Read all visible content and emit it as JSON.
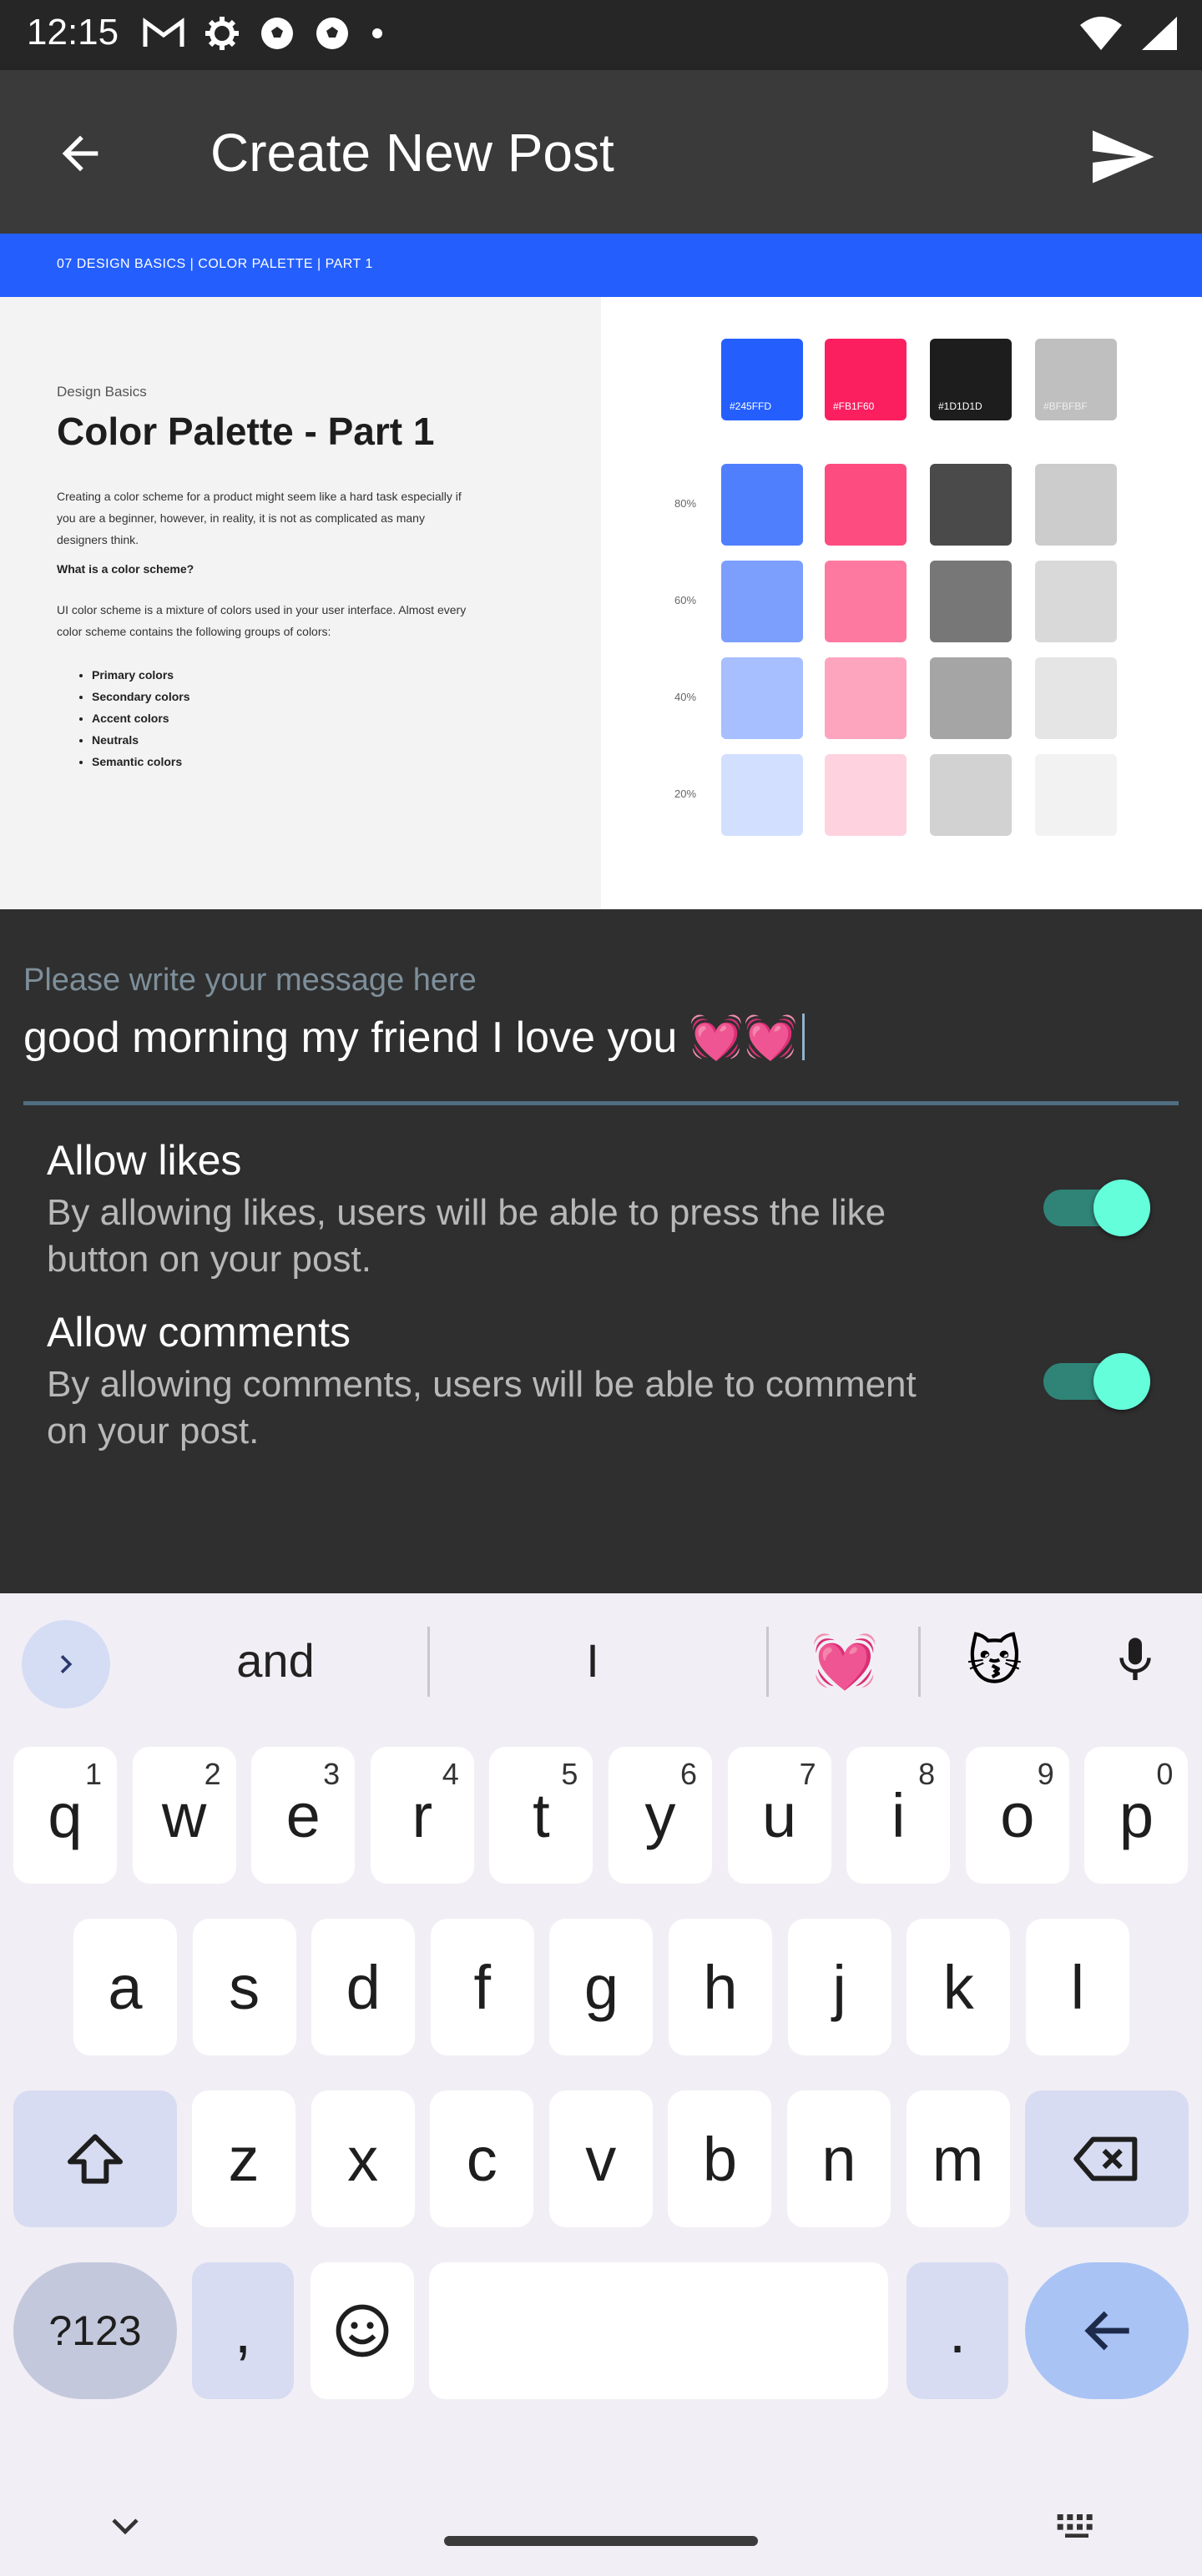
{
  "status_bar": {
    "time": "12:15",
    "icons": [
      "gmail-icon",
      "settings-icon",
      "soccer-ball-icon",
      "soccer-ball-icon",
      "dot-icon"
    ],
    "right_icons": [
      "wifi-icon",
      "signal-icon"
    ]
  },
  "app_bar": {
    "title": "Create New Post",
    "back_icon": "arrow-back-icon",
    "send_icon": "send-icon"
  },
  "post_image": {
    "banner": "07 DESIGN BASICS | COLOR PALETTE | PART 1",
    "subtitle": "Design Basics",
    "title": "Color Palette - Part 1",
    "paragraph1": "Creating a color scheme for a product might seem like a hard task especially if you are a beginner, however, in reality, it is not as complicated as many designers think.",
    "heading2": "What is a color scheme?",
    "paragraph2": "UI color scheme is a mixture of colors used in your user interface. Almost every color scheme contains the following groups of colors:",
    "list": [
      "Primary colors",
      "Secondary colors",
      "Accent colors",
      "Neutrals",
      "Semantic colors"
    ],
    "swatch_names": [
      "#245FFD",
      "#FB1F60",
      "#1D1D1D",
      "#BFBFBF"
    ],
    "shade_labels": [
      "80%",
      "60%",
      "40%",
      "20%"
    ],
    "colors": {
      "base": [
        "#245ffd",
        "#fb1f60",
        "#1d1d1d",
        "#bfbfbf"
      ],
      "80": [
        "#4f7ffd",
        "#fc4c80",
        "#4a4a4a",
        "#cccccc"
      ],
      "60": [
        "#7c9ffe",
        "#fd79a0",
        "#777777",
        "#d9d9d9"
      ],
      "40": [
        "#a7bffe",
        "#fda5bf",
        "#a5a5a5",
        "#e5e5e5"
      ],
      "20": [
        "#d3dfff",
        "#fed2df",
        "#d2d2d2",
        "#f2f2f2"
      ]
    }
  },
  "message": {
    "label": "Please write your message here",
    "value": "good morning my friend I love you 💓💓"
  },
  "settings": [
    {
      "title": "Allow likes",
      "description": "By allowing likes, users will be able to press the like button on your post.",
      "enabled": true
    },
    {
      "title": "Allow comments",
      "description": "By allowing comments, users will be able to comment on your post.",
      "enabled": true
    }
  ],
  "keyboard": {
    "suggestions": [
      "and",
      "I"
    ],
    "emoji_suggestions": [
      "💓",
      "😽"
    ],
    "row1": [
      [
        "q",
        "1"
      ],
      [
        "w",
        "2"
      ],
      [
        "e",
        "3"
      ],
      [
        "r",
        "4"
      ],
      [
        "t",
        "5"
      ],
      [
        "y",
        "6"
      ],
      [
        "u",
        "7"
      ],
      [
        "i",
        "8"
      ],
      [
        "o",
        "9"
      ],
      [
        "p",
        "0"
      ]
    ],
    "row2": [
      "a",
      "s",
      "d",
      "f",
      "g",
      "h",
      "j",
      "k",
      "l"
    ],
    "row3": [
      "z",
      "x",
      "c",
      "v",
      "b",
      "n",
      "m"
    ],
    "symbols_label": "?123",
    "comma": ",",
    "period": "."
  },
  "accent_colors": {
    "toggle_thumb": "#64ffda",
    "toggle_track": "#2f8477",
    "banner": "#245ffd"
  }
}
